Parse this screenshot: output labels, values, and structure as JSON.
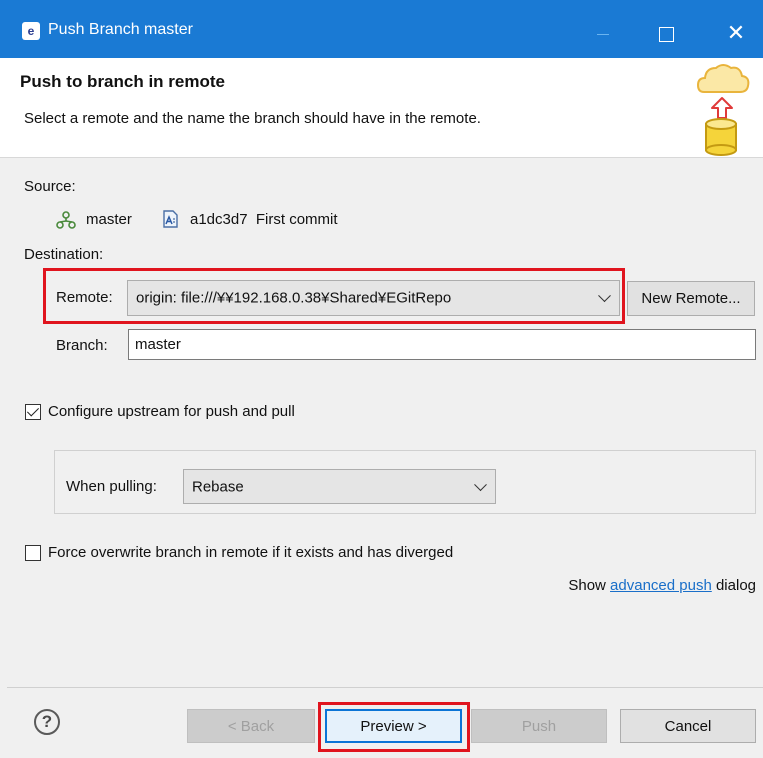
{
  "window": {
    "title": "Push Branch master",
    "app_icon_glyph": "e"
  },
  "banner": {
    "title": "Push to branch in remote",
    "description": "Select a remote and the name the branch should have in the remote.",
    "art_icon": "cloud-database-push-icon"
  },
  "source": {
    "label": "Source:",
    "branch": "master",
    "commit": "a1dc3d7  First commit"
  },
  "destination": {
    "label": "Destination:",
    "remote_label": "Remote:",
    "remote_value": "origin: file:///¥¥192.168.0.38¥Shared¥EGitRepo",
    "new_remote_button": "New Remote...",
    "branch_label": "Branch:",
    "branch_value": "master"
  },
  "upstream": {
    "label": "Configure upstream for push and pull",
    "checked": true,
    "pulling_label": "When pulling:",
    "pulling_value": "Rebase"
  },
  "force": {
    "label": "Force overwrite branch in remote if it exists and has diverged",
    "checked": false
  },
  "advanced": {
    "prefix": "Show ",
    "link": "advanced push",
    "suffix": " dialog"
  },
  "footer": {
    "help_glyph": "?",
    "back_button": "< Back",
    "preview_button": "Preview >",
    "push_button": "Push",
    "cancel_button": "Cancel"
  },
  "colors": {
    "titlebar": "#1a7ad4",
    "highlight": "#e0141e",
    "link": "#1a6fc9",
    "default_button_border": "#0a74d6"
  }
}
